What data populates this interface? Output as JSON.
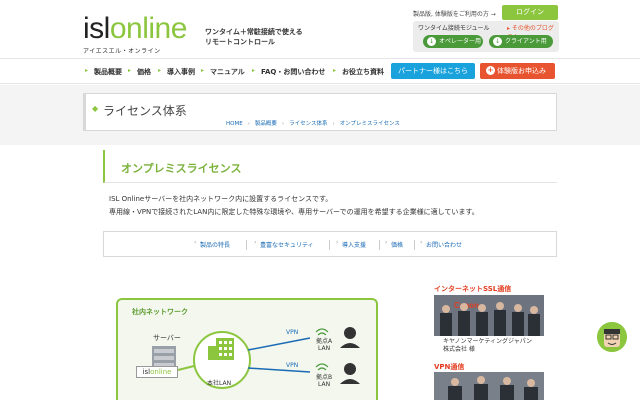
{
  "header": {
    "logo_isl": "isl",
    "logo_online": "online",
    "logo_sub": "アイエスエル・オンライン",
    "tagline_1": "ワンタイム＋常駐接続で使える",
    "tagline_2": "リモートコントロール",
    "trial_link": "製品版, 体験版をご利用の方 →",
    "login": "ログイン",
    "module_title": "ワンタイム接続モジュール",
    "other_programs": "その他のプログラム",
    "operator_btn": "オペレーター用",
    "client_btn": "クライアント用"
  },
  "nav": {
    "items": [
      "製品概要",
      "価格",
      "導入事例",
      "マニュアル",
      "FAQ・お問い合わせ",
      "お役立ち資料"
    ],
    "partner": "パートナー様はこちら",
    "trial": "体験版お申込み"
  },
  "page": {
    "title": "ライセンス体系",
    "breadcrumbs": [
      "HOME",
      "製品概要",
      "ライセンス体系",
      "オンプレミスライセンス"
    ]
  },
  "section": {
    "title": "オンプレミスライセンス",
    "desc_1": "ISL Onlineサーバーを社内ネットワーク内に設置するライセンスです。",
    "desc_2": "専用線・VPNで接続されたLAN内に限定した特殊な環境や、専用サーバーでの運用を希望する企業様に適しています。"
  },
  "subnav": [
    "製品の特長",
    "豊富なセキュリティ",
    "導入支援",
    "価格",
    "お問い合わせ"
  ],
  "diagram": {
    "title": "社内ネットワーク",
    "server": "サーバー",
    "isl_a": "isl",
    "isl_b": "online",
    "lan": "本社LAN",
    "vpn_1": "VPN",
    "vpn_2": "VPN",
    "base_a_1": "拠点A",
    "base_a_2": "LAN",
    "base_b_1": "拠点B",
    "base_b_2": "LAN"
  },
  "sidebar": {
    "ssl_head": "インターネットSSL通信",
    "caption_1": "キヤノンマーケティングジャパン",
    "caption_2": "株式会社 様",
    "vpn_head": "VPN通信",
    "photo_logo": "Canon"
  },
  "colors": {
    "brand_green": "#8cc63f",
    "partner_blue": "#19a2dc",
    "trial_red": "#e8542f",
    "link_blue": "#1a6bb5"
  }
}
